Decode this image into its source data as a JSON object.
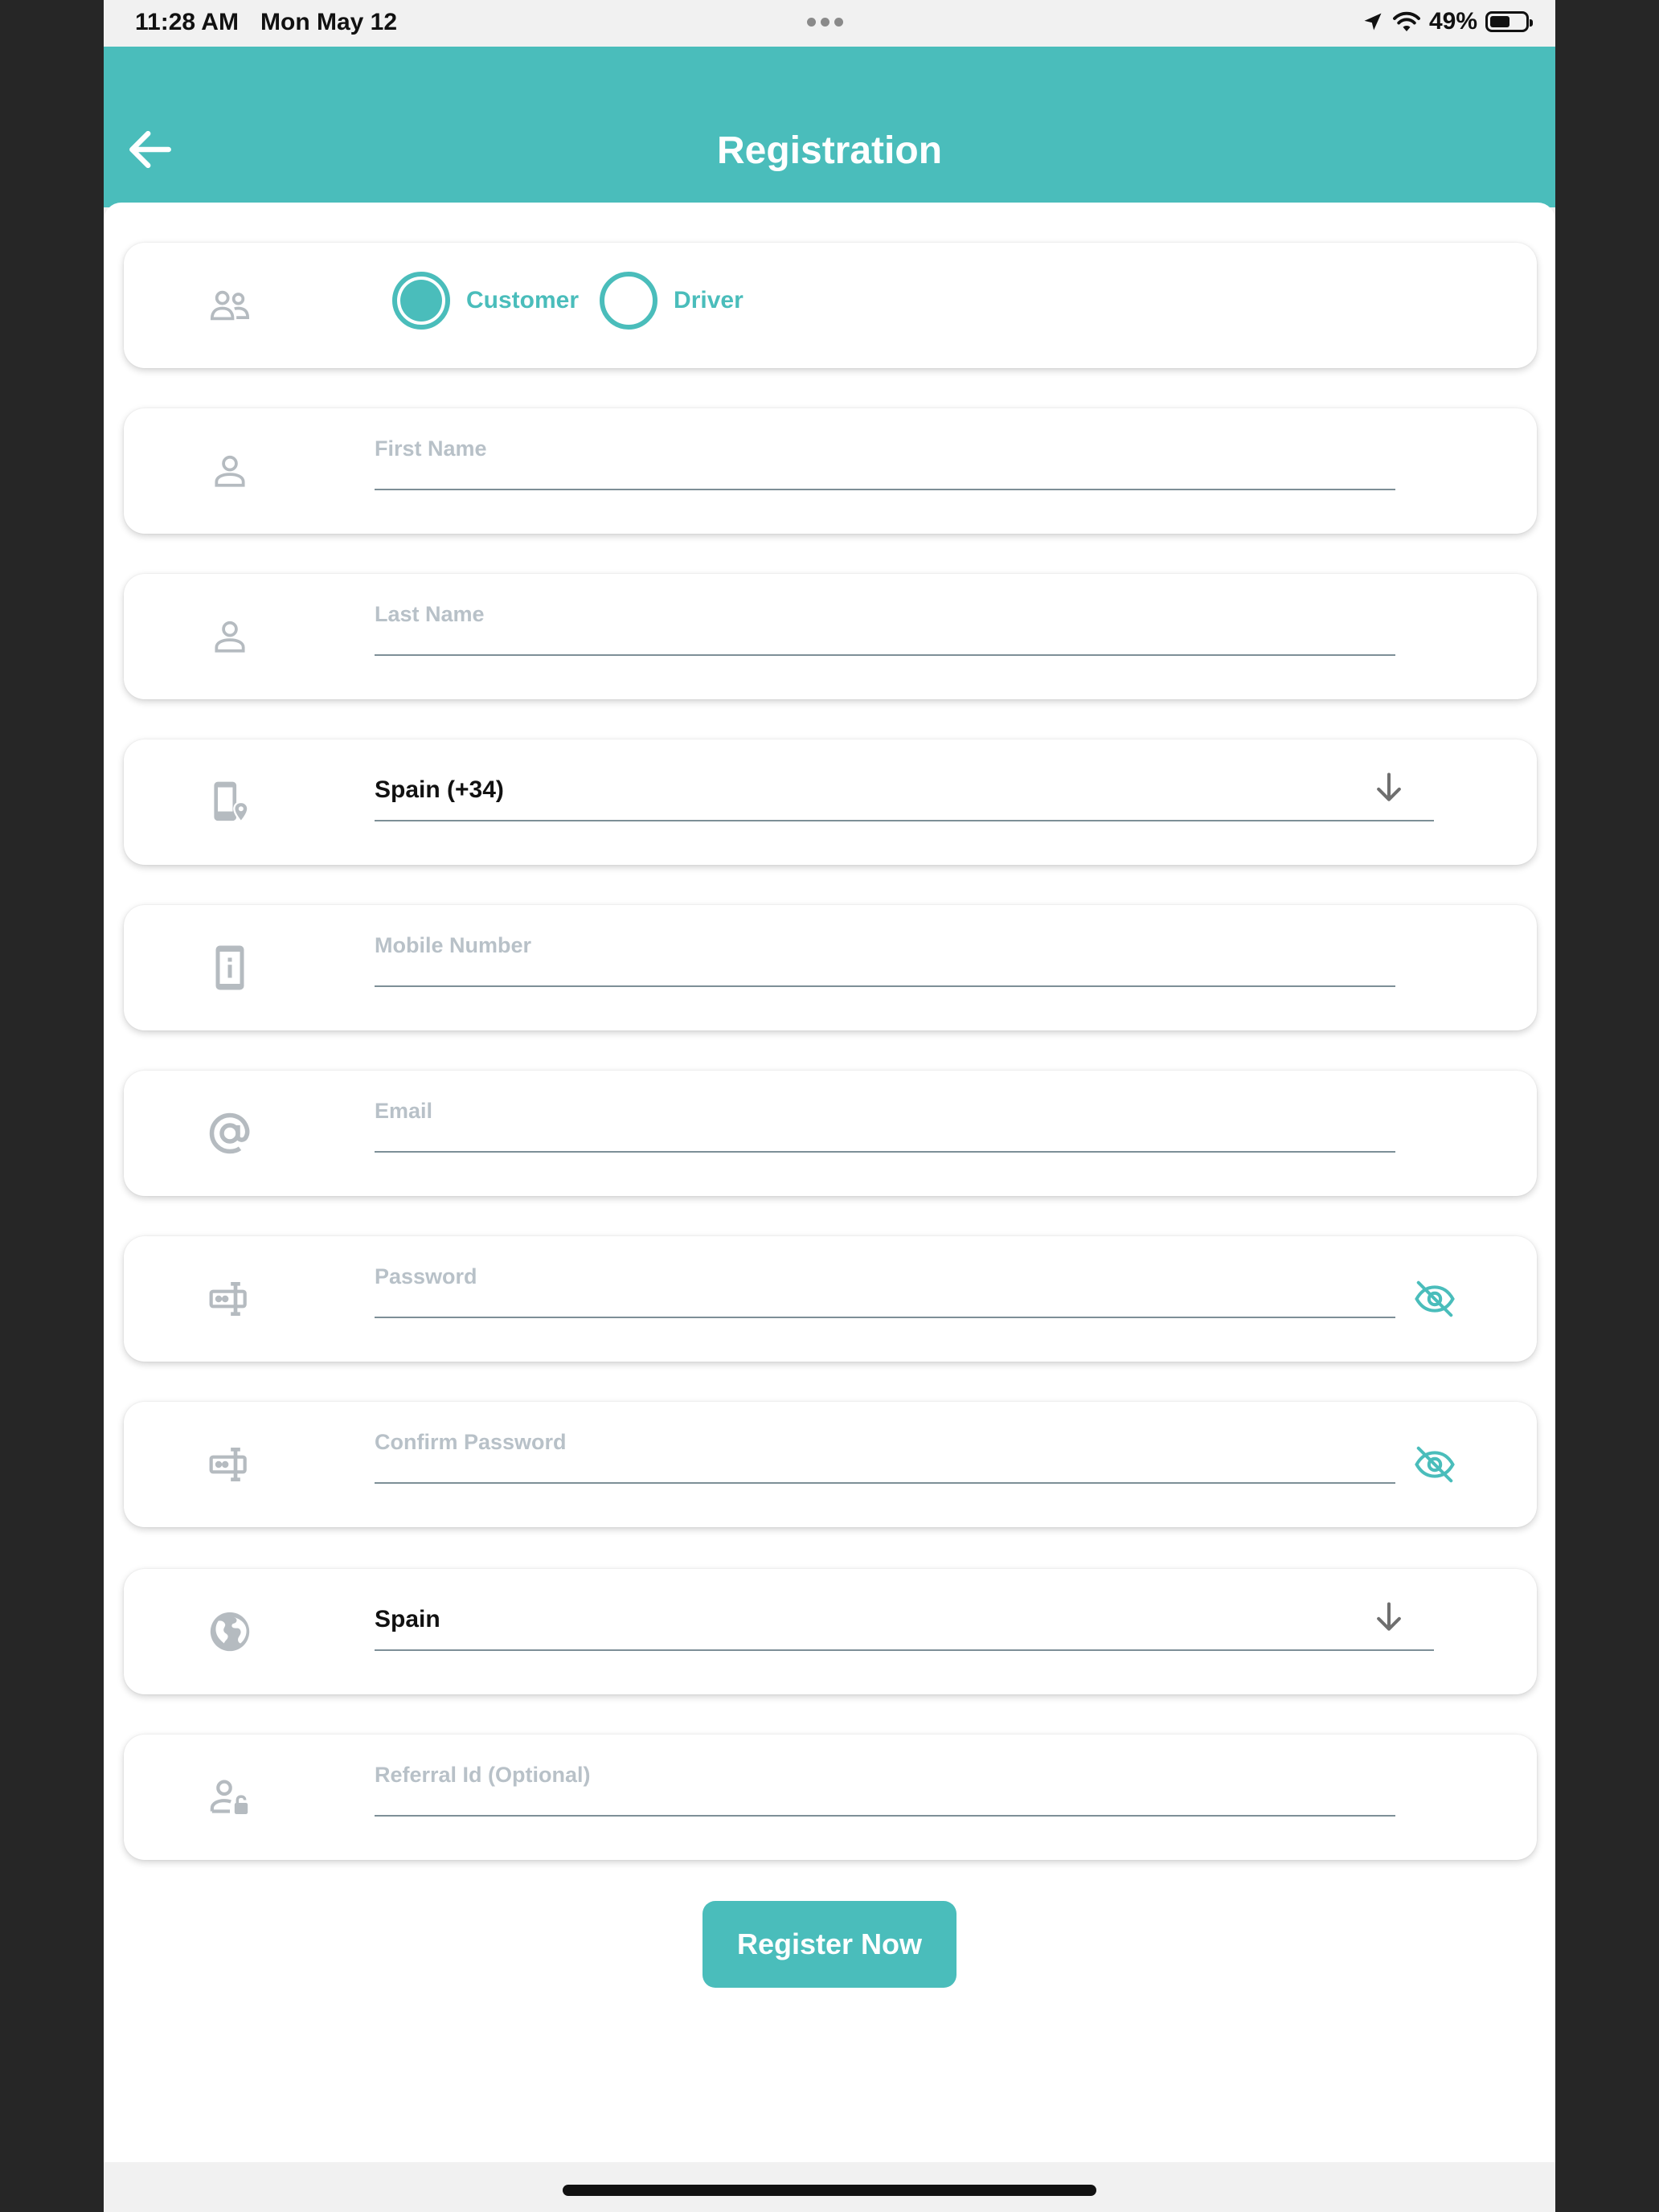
{
  "status_bar": {
    "time": "11:28 AM",
    "date": "Mon May 12",
    "battery": "49%",
    "battery_level": 0.49
  },
  "header": {
    "title": "Registration",
    "back_icon": "arrow-left-icon"
  },
  "user_type": {
    "icon": "users-icon",
    "options": [
      {
        "label": "Customer",
        "selected": true
      },
      {
        "label": "Driver",
        "selected": false
      }
    ]
  },
  "form": {
    "first_name": {
      "placeholder": "First Name",
      "value": "",
      "icon": "person-icon"
    },
    "last_name": {
      "placeholder": "Last Name",
      "value": "",
      "icon": "person-icon"
    },
    "country_code": {
      "value": "Spain (+34)",
      "icon": "phone-location-icon"
    },
    "mobile": {
      "placeholder": "Mobile Number",
      "value": "",
      "icon": "mobile-info-icon"
    },
    "email": {
      "placeholder": "Email",
      "value": "",
      "icon": "at-icon"
    },
    "password": {
      "placeholder": "Password",
      "value": "",
      "icon": "password-icon"
    },
    "confirm_password": {
      "placeholder": "Confirm Password",
      "value": "",
      "icon": "password-icon"
    },
    "country": {
      "value": "Spain",
      "icon": "globe-icon"
    },
    "referral": {
      "placeholder": "Referral Id (Optional)",
      "value": "",
      "icon": "person-lock-icon"
    }
  },
  "actions": {
    "register_label": "Register Now"
  },
  "colors": {
    "accent": "#4abdbb",
    "icon_gray": "#b5bbc0"
  }
}
